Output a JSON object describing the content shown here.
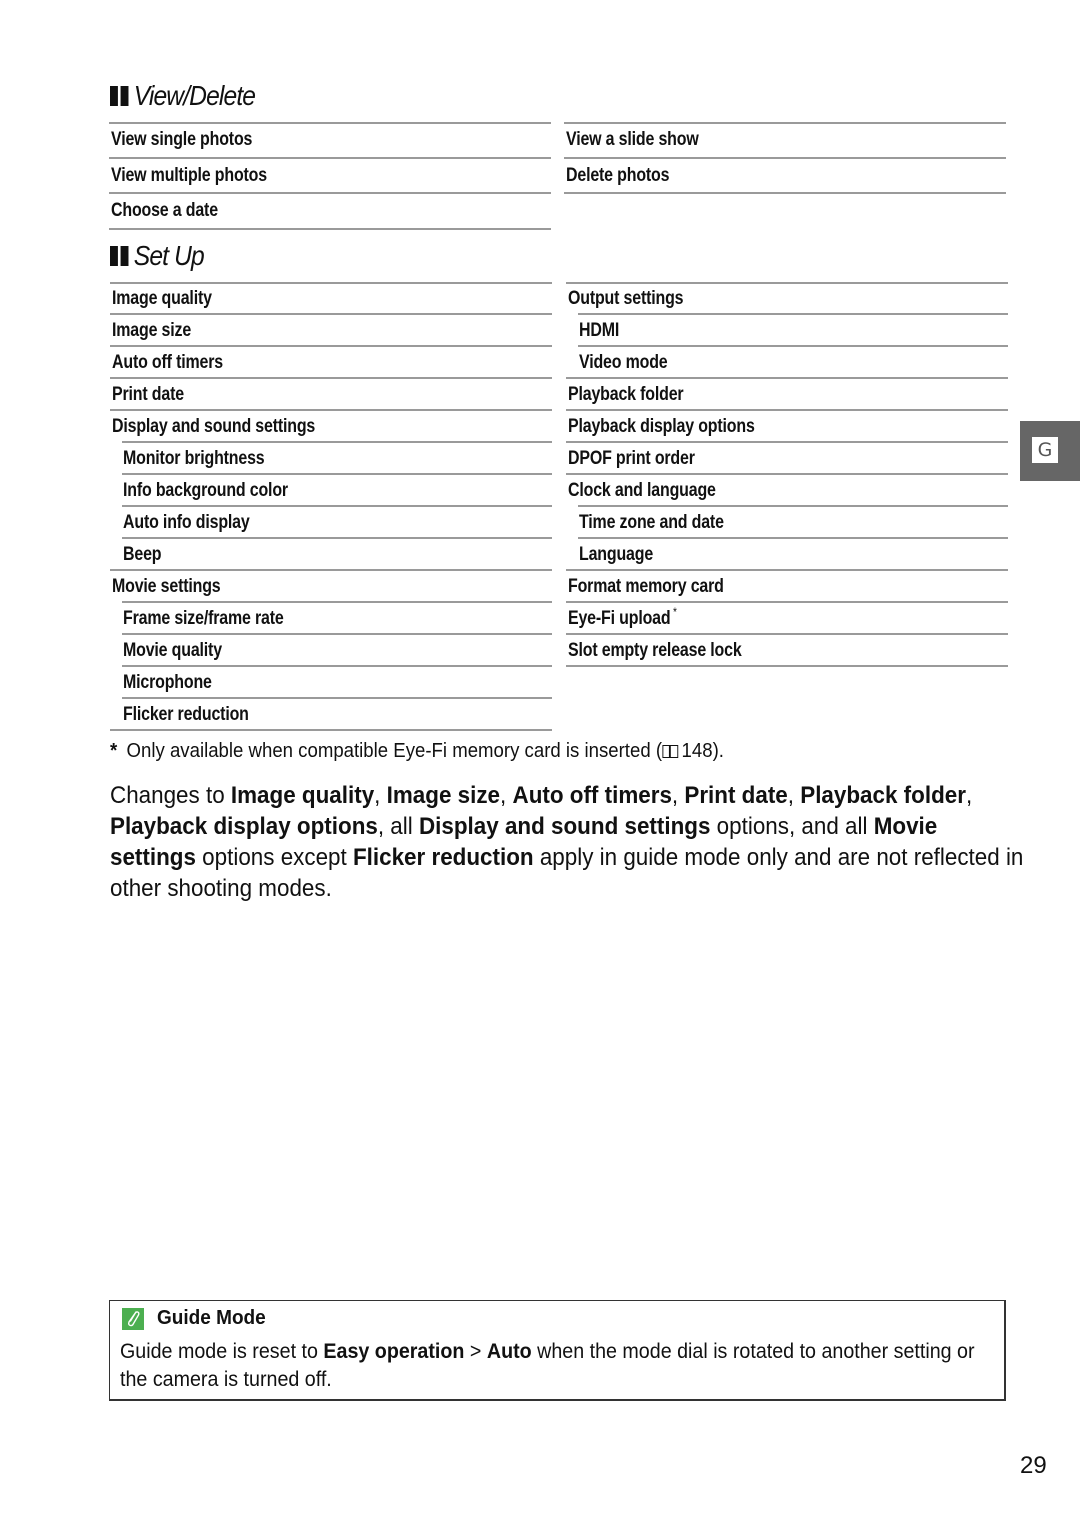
{
  "view_delete": {
    "heading": "View/Delete",
    "left": [
      "View single photos",
      "View multiple photos",
      "Choose a date"
    ],
    "right": [
      "View a slide show",
      "Delete photos"
    ]
  },
  "set_up": {
    "heading": "Set Up",
    "left": [
      {
        "label": "Image quality",
        "level": 0
      },
      {
        "label": "Image size",
        "level": 0
      },
      {
        "label": "Auto off timers",
        "level": 0
      },
      {
        "label": "Print date",
        "level": 0
      },
      {
        "label": "Display and sound settings",
        "level": 0
      },
      {
        "label": "Monitor brightness",
        "level": 1
      },
      {
        "label": "Info background color",
        "level": 1
      },
      {
        "label": "Auto info display",
        "level": 1
      },
      {
        "label": "Beep",
        "level": 1
      },
      {
        "label": "Movie settings",
        "level": 0
      },
      {
        "label": "Frame size/frame rate",
        "level": 1
      },
      {
        "label": "Movie quality",
        "level": 1
      },
      {
        "label": "Microphone",
        "level": 1
      },
      {
        "label": "Flicker reduction",
        "level": 1
      }
    ],
    "right": [
      {
        "label": "Output settings",
        "level": 0
      },
      {
        "label": "HDMI",
        "level": 1
      },
      {
        "label": "Video mode",
        "level": 1
      },
      {
        "label": "Playback folder",
        "level": 0
      },
      {
        "label": "Playback display options",
        "level": 0
      },
      {
        "label": "DPOF print order",
        "level": 0
      },
      {
        "label": "Clock and language",
        "level": 0
      },
      {
        "label": "Time zone and date",
        "level": 1
      },
      {
        "label": "Language",
        "level": 1
      },
      {
        "label": "Format memory card",
        "level": 0
      },
      {
        "label": "Eye-Fi upload",
        "level": 0,
        "footnote_marker": "*"
      },
      {
        "label": "Slot empty release lock",
        "level": 0
      }
    ]
  },
  "footnote": {
    "marker": "*",
    "text_before": "Only available when compatible Eye-Fi memory card is inserted (",
    "icon": "book-icon",
    "page_ref": "148",
    "text_after": ")."
  },
  "paragraph": [
    {
      "t": "Changes to ",
      "b": false
    },
    {
      "t": "Image quality",
      "b": true
    },
    {
      "t": ", ",
      "b": false
    },
    {
      "t": "Image size",
      "b": true
    },
    {
      "t": ", ",
      "b": false
    },
    {
      "t": "Auto off timers",
      "b": true
    },
    {
      "t": ", ",
      "b": false
    },
    {
      "t": "Print date",
      "b": true
    },
    {
      "t": ", ",
      "b": false
    },
    {
      "t": "Playback folder",
      "b": true
    },
    {
      "t": ", ",
      "b": false
    },
    {
      "t": "Playback display options",
      "b": true
    },
    {
      "t": ", all ",
      "b": false
    },
    {
      "t": "Display and sound settings",
      "b": true
    },
    {
      "t": " options, and all ",
      "b": false
    },
    {
      "t": "Movie settings",
      "b": true
    },
    {
      "t": " options except ",
      "b": false
    },
    {
      "t": "Flicker reduction",
      "b": true
    },
    {
      "t": " apply in guide mode only and are not reflected in other shooting modes.",
      "b": false
    }
  ],
  "note": {
    "icon": "pencil-note-icon",
    "title": "Guide Mode",
    "body": [
      {
        "t": "Guide mode is reset to ",
        "b": false
      },
      {
        "t": "Easy operation",
        "b": true
      },
      {
        "t": " > ",
        "b": false
      },
      {
        "t": "Auto",
        "b": true
      },
      {
        "t": " when the mode dial is rotated to another setting or the camera is turned off.",
        "b": false
      }
    ]
  },
  "side_tab": {
    "label": "G"
  },
  "page_number": "29",
  "colors": {
    "rule": "#9a9a9a",
    "note_icon": "#4caf50",
    "side_tab": "#666666"
  }
}
